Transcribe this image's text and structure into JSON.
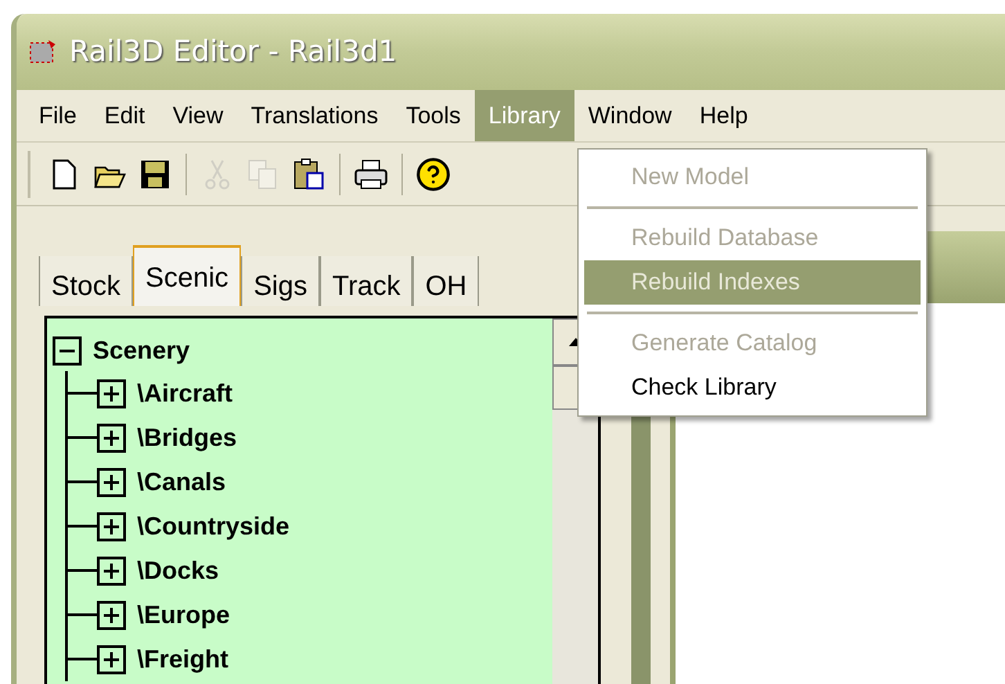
{
  "window": {
    "title": "Rail3D Editor - Rail3d1"
  },
  "menu_bar": [
    {
      "label": "File",
      "selected": false
    },
    {
      "label": "Edit",
      "selected": false
    },
    {
      "label": "View",
      "selected": false
    },
    {
      "label": "Translations",
      "selected": false
    },
    {
      "label": "Tools",
      "selected": false
    },
    {
      "label": "Library",
      "selected": true
    },
    {
      "label": "Window",
      "selected": false
    },
    {
      "label": "Help",
      "selected": false
    }
  ],
  "toolbar": [
    {
      "kind": "new",
      "disabled": false
    },
    {
      "kind": "open",
      "disabled": false
    },
    {
      "kind": "save",
      "disabled": false
    },
    {
      "kind": "separator"
    },
    {
      "kind": "cut",
      "disabled": true
    },
    {
      "kind": "copy",
      "disabled": true
    },
    {
      "kind": "paste",
      "disabled": false
    },
    {
      "kind": "separator"
    },
    {
      "kind": "print",
      "disabled": false
    },
    {
      "kind": "separator"
    },
    {
      "kind": "help",
      "disabled": false
    }
  ],
  "tabs": [
    {
      "label": "Stock",
      "selected": false
    },
    {
      "label": "Scenic",
      "selected": true
    },
    {
      "label": "Sigs",
      "selected": false
    },
    {
      "label": "Track",
      "selected": false
    },
    {
      "label": "OH",
      "selected": false
    }
  ],
  "tree": {
    "label": "Scenery",
    "expanded": true,
    "children": [
      {
        "label": "\\Aircraft",
        "expanded": false
      },
      {
        "label": "\\Bridges",
        "expanded": false
      },
      {
        "label": "\\Canals",
        "expanded": false
      },
      {
        "label": "\\Countryside",
        "expanded": false
      },
      {
        "label": "\\Docks",
        "expanded": false
      },
      {
        "label": "\\Europe",
        "expanded": false
      },
      {
        "label": "\\Freight",
        "expanded": false
      }
    ]
  },
  "library_menu": [
    {
      "kind": "item",
      "label": "New Model",
      "disabled": true,
      "selected": false
    },
    {
      "kind": "separator"
    },
    {
      "kind": "item",
      "label": "Rebuild Database",
      "disabled": true,
      "selected": false
    },
    {
      "kind": "item",
      "label": "Rebuild Indexes",
      "disabled": true,
      "selected": true
    },
    {
      "kind": "separator"
    },
    {
      "kind": "item",
      "label": "Generate Catalog",
      "disabled": true,
      "selected": false
    },
    {
      "kind": "item",
      "label": "Check Library",
      "disabled": false,
      "selected": false
    }
  ]
}
